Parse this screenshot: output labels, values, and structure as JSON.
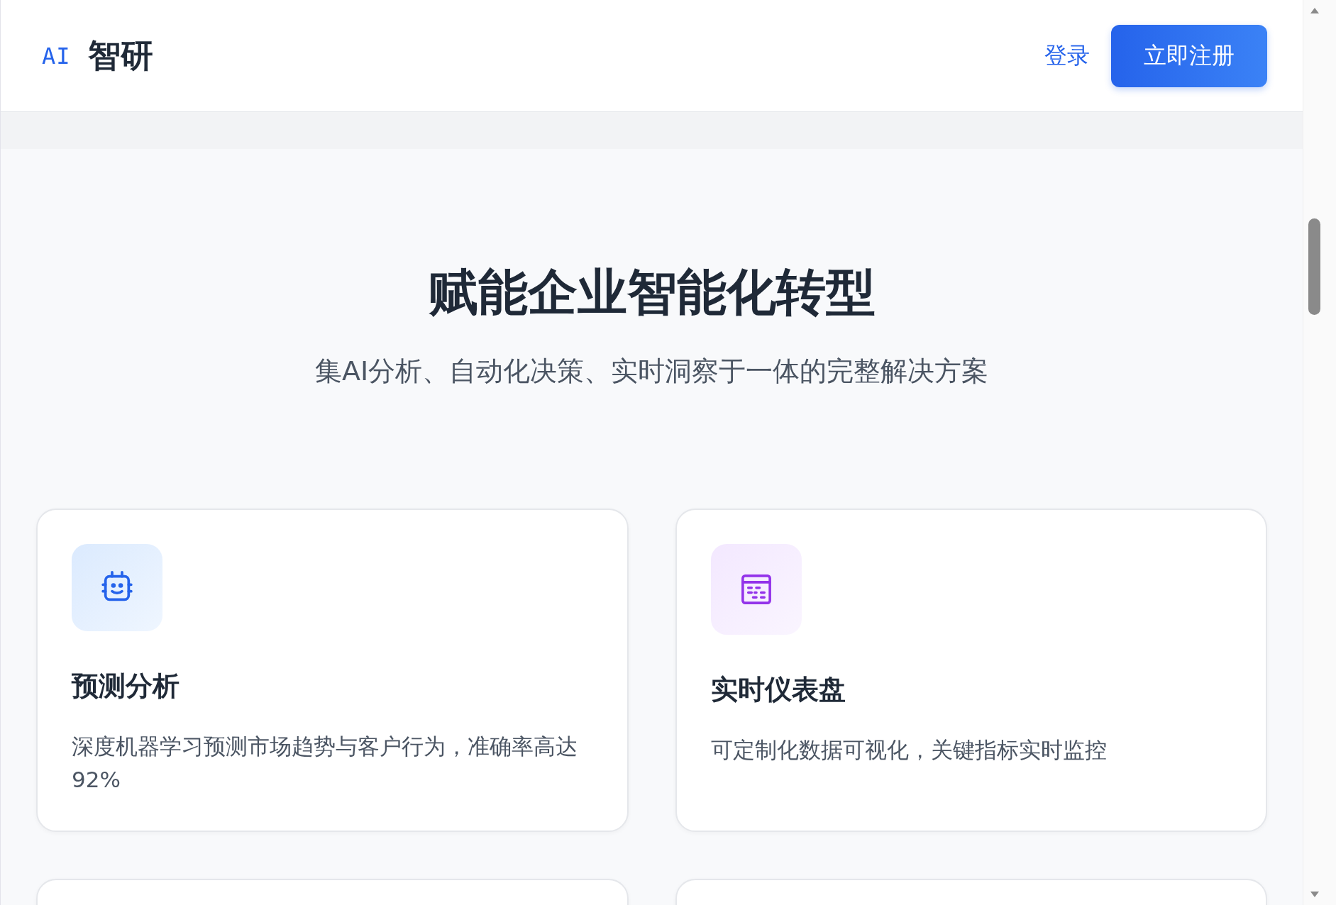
{
  "header": {
    "logo_mark": "AI",
    "brand": "智研",
    "login": "登录",
    "signup": "立即注册"
  },
  "hero": {
    "title": "赋能企业智能化转型",
    "subtitle": "集AI分析、自动化决策、实时洞察于一体的完整解决方案"
  },
  "features": [
    {
      "kind": "robot",
      "title": "预测分析",
      "description": "深度机器学习预测市场趋势与客户行为，准确率高达92%"
    },
    {
      "kind": "dashboard",
      "title": "实时仪表盘",
      "description": "可定制化数据可视化，关键指标实时监控"
    }
  ]
}
